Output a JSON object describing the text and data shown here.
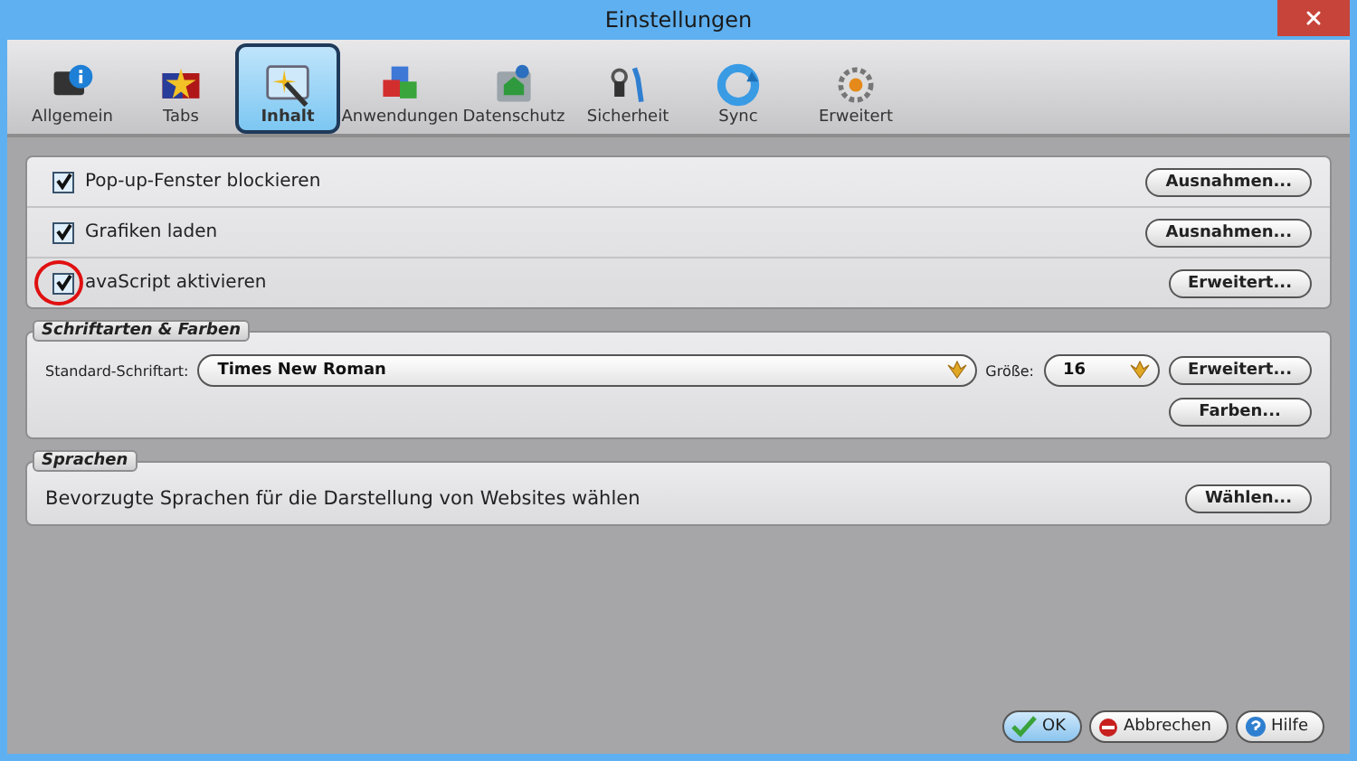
{
  "window": {
    "title": "Einstellungen"
  },
  "tabs": [
    {
      "label": "Allgemein",
      "selected": false
    },
    {
      "label": "Tabs",
      "selected": false
    },
    {
      "label": "Inhalt",
      "selected": true
    },
    {
      "label": "Anwendungen",
      "selected": false
    },
    {
      "label": "Datenschutz",
      "selected": false
    },
    {
      "label": "Sicherheit",
      "selected": false
    },
    {
      "label": "Sync",
      "selected": false
    },
    {
      "label": "Erweitert",
      "selected": false
    }
  ],
  "options": [
    {
      "label": "Pop-up-Fenster blockieren",
      "checked": true,
      "circled": false,
      "button": "Ausnahmen..."
    },
    {
      "label": "Grafiken laden",
      "checked": true,
      "circled": false,
      "button": "Ausnahmen..."
    },
    {
      "label": "avaScript aktivieren",
      "checked": true,
      "circled": true,
      "button": "Erweitert..."
    }
  ],
  "fonts": {
    "legend": "Schriftarten & Farben",
    "font_label": "Standard-Schriftart:",
    "font_value": "Times New Roman",
    "size_label": "Größe:",
    "size_value": "16",
    "buttons": [
      "Erweitert...",
      "Farben..."
    ]
  },
  "languages": {
    "legend": "Sprachen",
    "text": "Bevorzugte Sprachen für die Darstellung von Websites wählen",
    "button": "Wählen..."
  },
  "footer_buttons": [
    {
      "label": "OK",
      "kind": "ok"
    },
    {
      "label": "Abbrechen",
      "kind": "cancel"
    },
    {
      "label": "Hilfe",
      "kind": "help"
    }
  ]
}
